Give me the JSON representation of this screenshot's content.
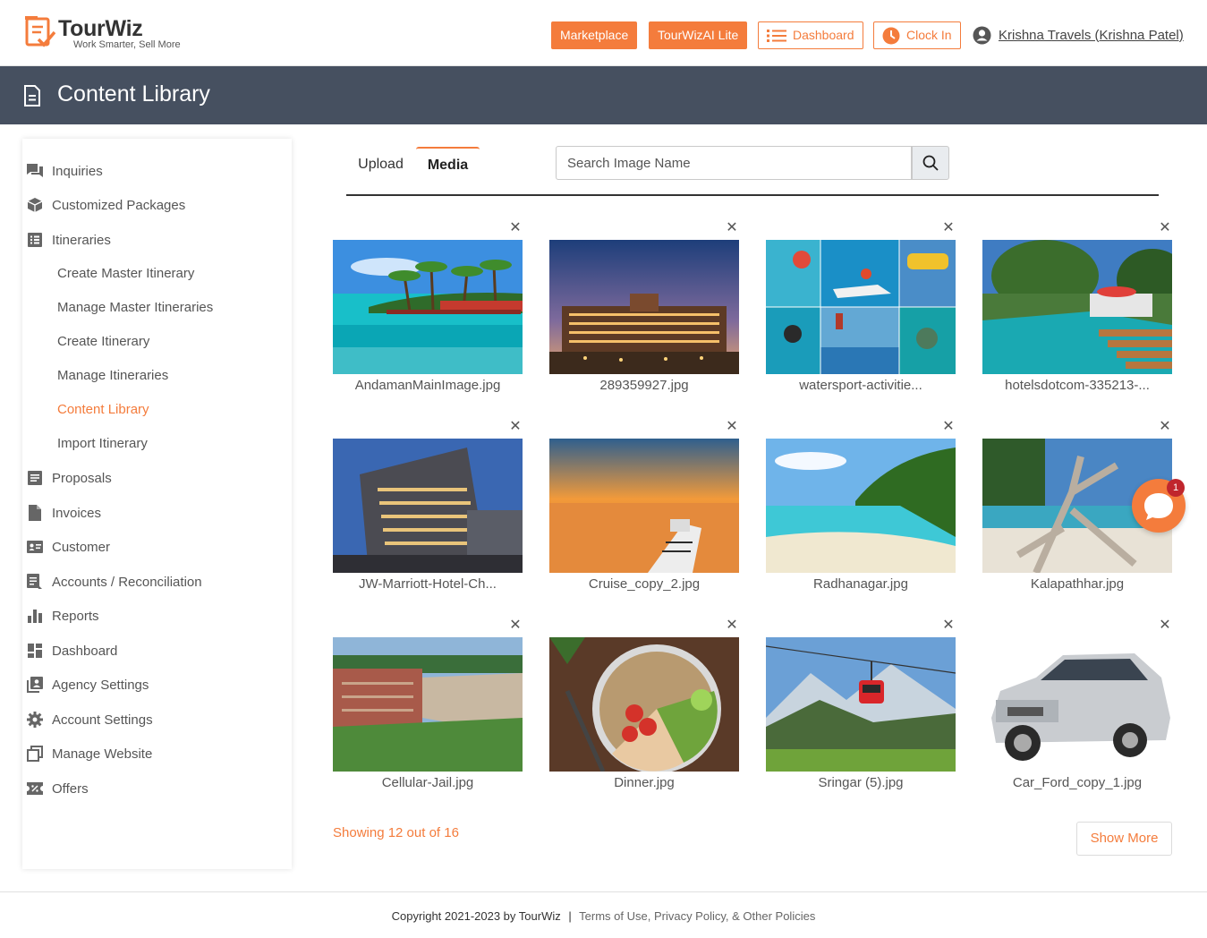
{
  "brand": {
    "name": "TourWiz",
    "tagline": "Work Smarter, Sell More"
  },
  "header": {
    "marketplace": "Marketplace",
    "ai_lite": "TourWizAI Lite",
    "dashboard": "Dashboard",
    "clock_in": "Clock In",
    "user": "Krishna Travels (Krishna Patel)"
  },
  "page_title": "Content Library",
  "sidebar": {
    "items": [
      {
        "label": "Inquiries",
        "icon": "chat-icon"
      },
      {
        "label": "Customized Packages",
        "icon": "package-icon"
      },
      {
        "label": "Itineraries",
        "icon": "list-icon"
      },
      {
        "label": "Proposals",
        "icon": "document-lines-icon"
      },
      {
        "label": "Invoices",
        "icon": "file-icon"
      },
      {
        "label": "Customer",
        "icon": "contact-card-icon"
      },
      {
        "label": "Accounts / Reconciliation",
        "icon": "ledger-icon"
      },
      {
        "label": "Reports",
        "icon": "bar-chart-icon"
      },
      {
        "label": "Dashboard",
        "icon": "grid-icon"
      },
      {
        "label": "Agency Settings",
        "icon": "person-box-icon"
      },
      {
        "label": "Account Settings",
        "icon": "gear-icon"
      },
      {
        "label": "Manage Website",
        "icon": "pages-icon"
      },
      {
        "label": "Offers",
        "icon": "ticket-icon"
      }
    ],
    "subitems": [
      "Create Master Itinerary",
      "Manage Master Itineraries",
      "Create Itinerary",
      "Manage Itineraries",
      "Content Library",
      "Import Itinerary"
    ],
    "active_subitem": "Content Library"
  },
  "tabs": {
    "upload": "Upload",
    "media": "Media",
    "active": "Media"
  },
  "search": {
    "placeholder": "Search Image Name",
    "value": ""
  },
  "images": [
    {
      "caption": "AndamanMainImage.jpg",
      "scene": "tropical-pier"
    },
    {
      "caption": "289359927.jpg",
      "scene": "hotel-dusk"
    },
    {
      "caption": "watersport-activitie...",
      "scene": "collage"
    },
    {
      "caption": "hotelsdotcom-335213-...",
      "scene": "resort-pool"
    },
    {
      "caption": "JW-Marriott-Hotel-Ch...",
      "scene": "tower-hotel"
    },
    {
      "caption": "Cruise_copy_2.jpg",
      "scene": "cruise-sunset"
    },
    {
      "caption": "Radhanagar.jpg",
      "scene": "beach-forest"
    },
    {
      "caption": "Kalapathhar.jpg",
      "scene": "driftwood-beach"
    },
    {
      "caption": "Cellular-Jail.jpg",
      "scene": "jail-garden"
    },
    {
      "caption": "Dinner.jpg",
      "scene": "food-bowl"
    },
    {
      "caption": "Sringar (5).jpg",
      "scene": "cable-car"
    },
    {
      "caption": "Car_Ford_copy_1.jpg",
      "scene": "silver-suv"
    }
  ],
  "pagination": {
    "showing": "Showing 12 out of 16",
    "show_more": "Show More"
  },
  "chat": {
    "unread": "1"
  },
  "footer": {
    "copyright": "Copyright 2021-2023 by TourWiz",
    "separator": "|",
    "links": "Terms of Use, Privacy Policy, & Other Policies"
  },
  "colors": {
    "accent": "#f47c3c",
    "title_band": "#465060",
    "badge": "#c0262d"
  }
}
